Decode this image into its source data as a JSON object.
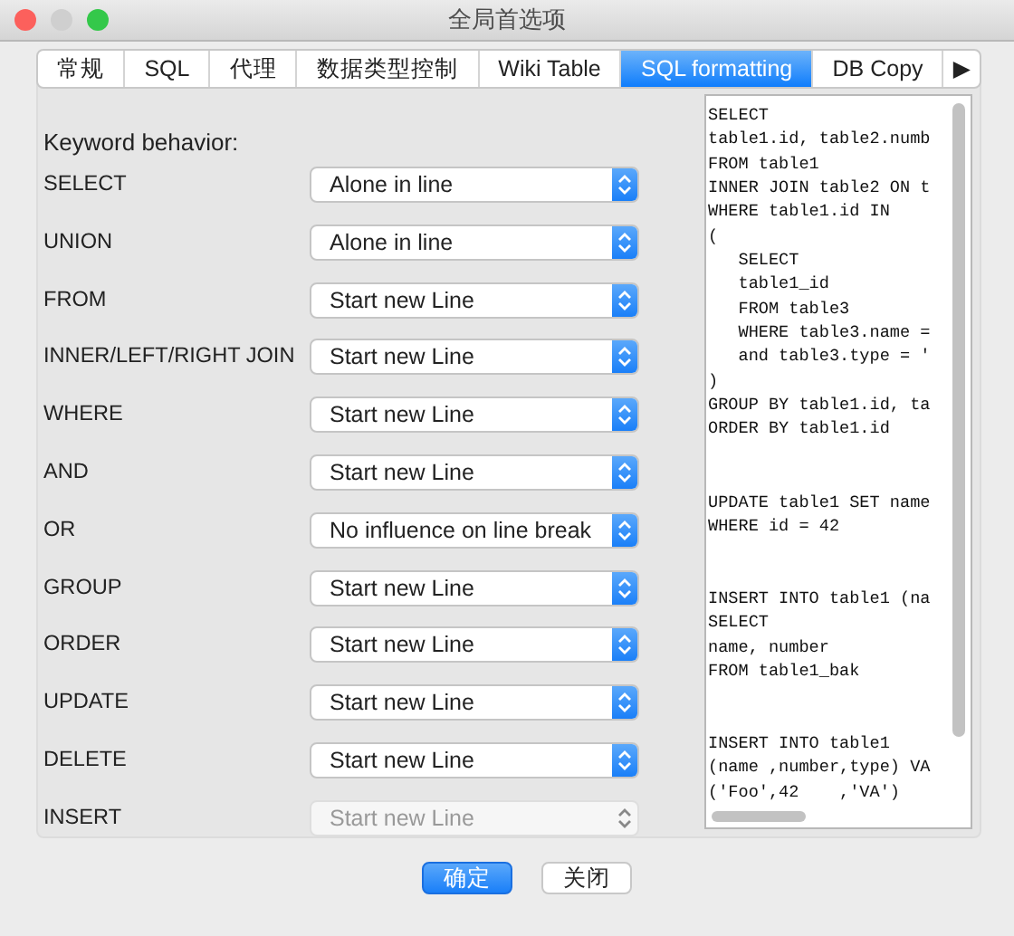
{
  "window": {
    "title": "全局首选项"
  },
  "tabs": [
    {
      "label": "常规",
      "selected": false
    },
    {
      "label": "SQL",
      "selected": false
    },
    {
      "label": "代理",
      "selected": false
    },
    {
      "label": "数据类型控制",
      "selected": false
    },
    {
      "label": "Wiki Table",
      "selected": false
    },
    {
      "label": "SQL formatting",
      "selected": true
    },
    {
      "label": "DB Copy",
      "selected": false
    }
  ],
  "tab_overflow": "▶",
  "section_label": "Keyword behavior:",
  "keywords": [
    {
      "label": "SELECT",
      "value": "Alone in line",
      "disabled": false
    },
    {
      "label": "UNION",
      "value": "Alone in line",
      "disabled": false
    },
    {
      "label": "FROM",
      "value": "Start new Line",
      "disabled": false
    },
    {
      "label": "INNER/LEFT/RIGHT JOIN",
      "value": "Start new Line",
      "disabled": false
    },
    {
      "label": "WHERE",
      "value": "Start new Line",
      "disabled": false
    },
    {
      "label": "AND",
      "value": "Start new Line",
      "disabled": false
    },
    {
      "label": "OR",
      "value": "No influence on line break",
      "disabled": false
    },
    {
      "label": "GROUP",
      "value": "Start new Line",
      "disabled": false
    },
    {
      "label": "ORDER",
      "value": "Start new Line",
      "disabled": false
    },
    {
      "label": "UPDATE",
      "value": "Start new Line",
      "disabled": false
    },
    {
      "label": "DELETE",
      "value": "Start new Line",
      "disabled": false
    },
    {
      "label": "INSERT",
      "value": "Start new Line",
      "disabled": true
    }
  ],
  "preview": "SELECT\ntable1.id, table2.numb\nFROM table1\nINNER JOIN table2 ON t\nWHERE table1.id IN\n(\n   SELECT\n   table1_id\n   FROM table3\n   WHERE table3.name =\n   and table3.type = '\n)\nGROUP BY table1.id, ta\nORDER BY table1.id\n\n\nUPDATE table1 SET name\nWHERE id = 42\n\n\nINSERT INTO table1 (na\nSELECT\nname, number\nFROM table1_bak\n\n\nINSERT INTO table1\n(name ,number,type) VA\n('Foo',42    ,'VA')",
  "buttons": [
    {
      "label": "确定",
      "default": true
    },
    {
      "label": "关闭",
      "default": false
    }
  ]
}
